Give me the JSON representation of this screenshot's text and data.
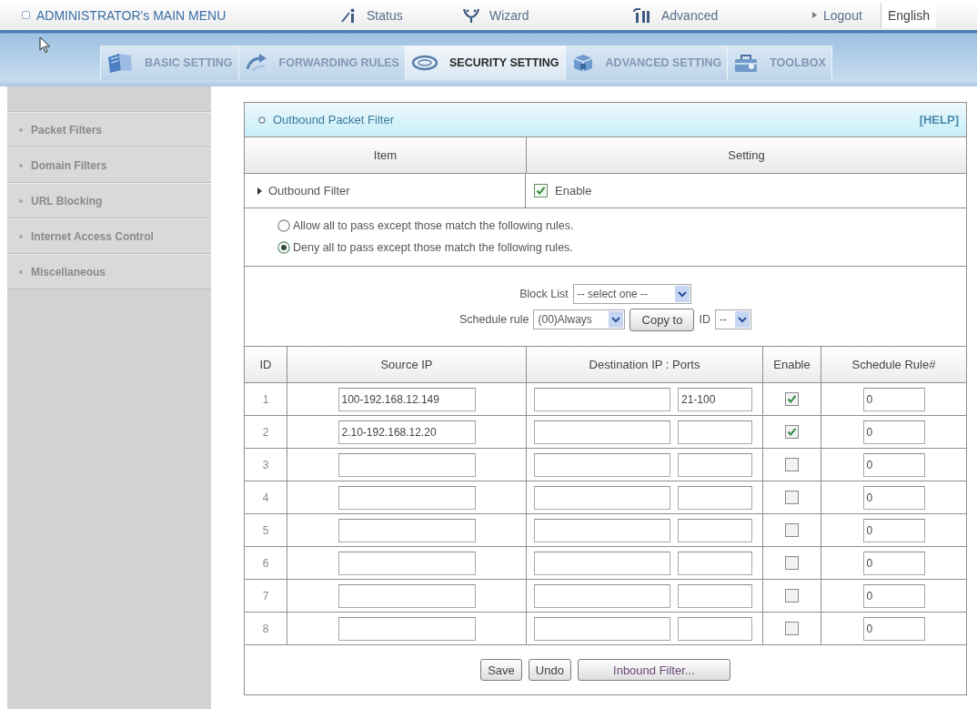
{
  "top_menu": {
    "title": "ADMINISTRATOR's MAIN MENU",
    "links": [
      {
        "label": "Status"
      },
      {
        "label": "Wizard"
      },
      {
        "label": "Advanced"
      }
    ],
    "logout": "Logout",
    "language": "English"
  },
  "tabs": [
    {
      "label": "BASIC SETTING",
      "selected": false
    },
    {
      "label": "FORWARDING RULES",
      "selected": false
    },
    {
      "label": "SECURITY SETTING",
      "selected": true
    },
    {
      "label": "ADVANCED SETTING",
      "selected": false
    },
    {
      "label": "TOOLBOX",
      "selected": false
    }
  ],
  "sidebar": {
    "items": [
      {
        "label": "Packet Filters"
      },
      {
        "label": "Domain Filters"
      },
      {
        "label": "URL Blocking"
      },
      {
        "label": "Internet Access Control"
      },
      {
        "label": "Miscellaneous"
      }
    ]
  },
  "panel": {
    "title": "Outbound Packet Filter",
    "help": "[HELP]",
    "columns": [
      "Item",
      "Setting"
    ],
    "outbound_filter": {
      "label": "Outbound Filter",
      "option": "Enable",
      "checked": true
    },
    "policy": [
      {
        "label": "Allow all to pass except those match the following rules.",
        "selected": false
      },
      {
        "label": "Deny all to pass except those match the following rules.",
        "selected": true
      }
    ],
    "block_list": {
      "label": "Block List",
      "value": "-- select one --"
    },
    "schedule_rule": {
      "label": "Schedule rule",
      "value": "(00)Always"
    },
    "copy_button": "Copy to",
    "copy_target": {
      "label": "ID",
      "value": "--"
    },
    "table": {
      "columns": [
        "ID",
        "Source IP",
        "Destination IP : Ports",
        "Enable",
        "Schedule Rule#"
      ],
      "rows": [
        {
          "id": "1",
          "source_ip": "100-192.168.12.149",
          "ports": "21-100",
          "enabled": true,
          "schedule_rule": "0"
        },
        {
          "id": "2",
          "source_ip": "2.10-192.168.12.20",
          "enabled": true,
          "schedule_rule": "0"
        },
        {
          "id": "3",
          "enabled": false,
          "schedule_rule": "0"
        },
        {
          "id": "4",
          "enabled": false,
          "schedule_rule": "0"
        },
        {
          "id": "5",
          "enabled": false,
          "schedule_rule": "0"
        },
        {
          "id": "6",
          "enabled": false,
          "schedule_rule": "0"
        },
        {
          "id": "7",
          "enabled": false,
          "schedule_rule": "0"
        },
        {
          "id": "8",
          "enabled": false,
          "schedule_rule": "0"
        }
      ]
    },
    "buttons": [
      {
        "label": "Save"
      },
      {
        "label": "Undo"
      },
      {
        "label": "Inbound Filter..."
      }
    ]
  }
}
